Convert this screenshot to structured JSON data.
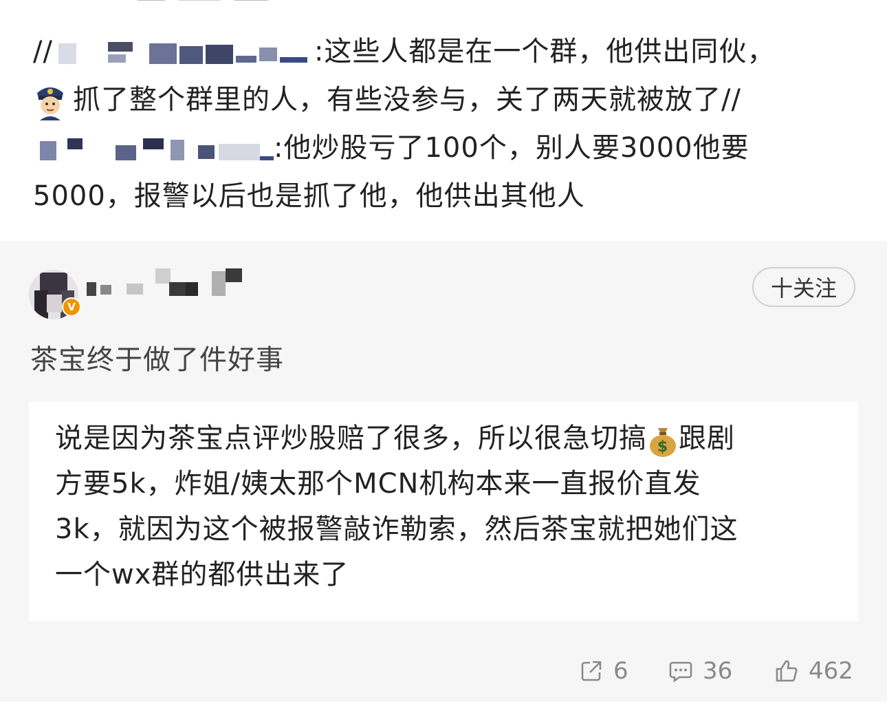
{
  "repost": {
    "prefix": "//",
    "text_1": ":这些人都是在一个群，他供出同伙，",
    "text_2": "抓了整个群里的人，有些没参与，关了两天就被放了//",
    "text_3": ":他炒股亏了100个，别人要3000他要",
    "text_4": "5000，报警以后也是抓了他，他供出其他人"
  },
  "comment": {
    "follow_label": "十关注",
    "text": "茶宝终于做了件好事",
    "verified_badge": "V",
    "quote": {
      "line_1": "说是因为茶宝点评炒股赔了很多，所以很急切搞",
      "line_1b": "跟剧",
      "line_2": "方要5k，炸姐/姨太那个MCN机构本来一直报价直发",
      "line_3": "3k，就因为这个被报警敲诈勒索，然后茶宝就把她们这",
      "line_4": "一个wx群的都供出来了"
    }
  },
  "actions": {
    "share_count": "6",
    "comment_count": "36",
    "like_count": "462"
  },
  "icons": [
    "police-emoji",
    "money-bag-emoji",
    "share-icon",
    "comment-icon",
    "like-icon"
  ],
  "colors": {
    "comment_bg": "#f6f6f6",
    "quote_bg": "#ffffff",
    "verified": "#f29400",
    "action_gray": "#8a8a8a"
  }
}
